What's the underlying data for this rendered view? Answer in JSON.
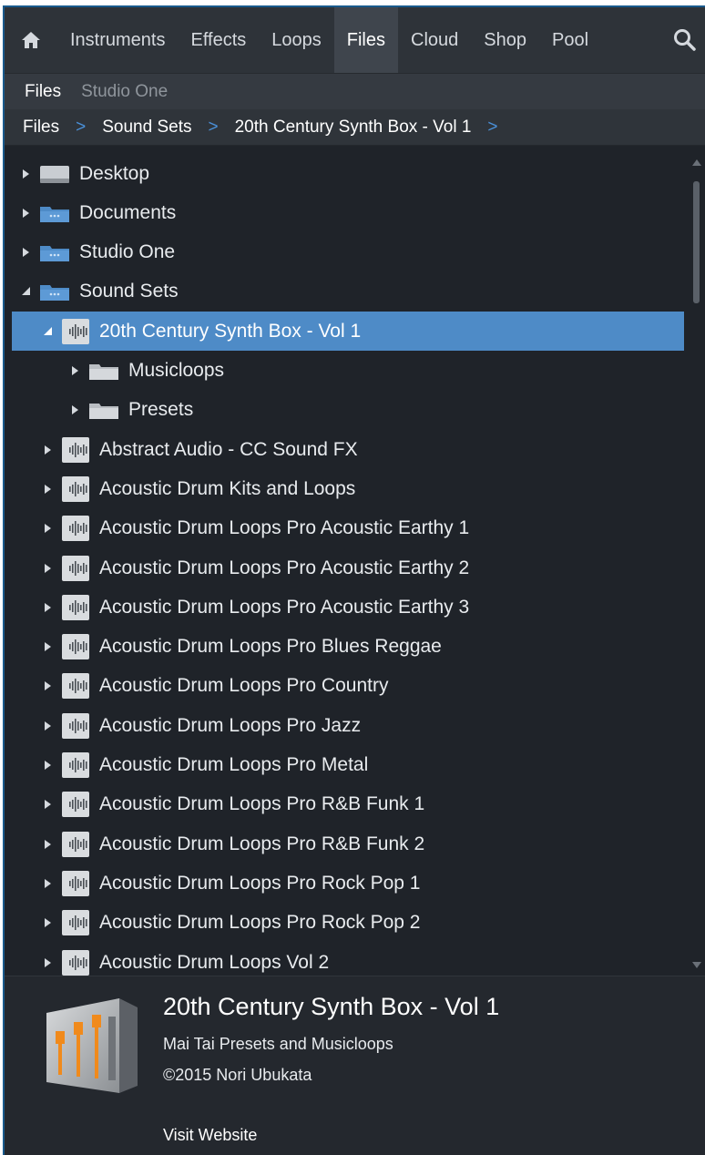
{
  "topbar": {
    "tabs": [
      "Instruments",
      "Effects",
      "Loops",
      "Files",
      "Cloud",
      "Shop",
      "Pool"
    ],
    "active_tab": "Files",
    "home_icon": "home-icon",
    "search_icon": "search-icon"
  },
  "subbar": {
    "tabs": [
      "Files",
      "Studio One"
    ],
    "active": "Files"
  },
  "breadcrumb": [
    "Files",
    "Sound Sets",
    "20th Century Synth Box - Vol 1"
  ],
  "breadcrumb_sep": ">",
  "tree": {
    "rows": [
      {
        "label": "Desktop",
        "icon": "drive-icon",
        "level": 0,
        "expanded": false
      },
      {
        "label": "Documents",
        "icon": "folder-icon",
        "level": 0,
        "expanded": false
      },
      {
        "label": "Studio One",
        "icon": "folder-icon",
        "level": 0,
        "expanded": false
      },
      {
        "label": "Sound Sets",
        "icon": "folder-icon",
        "level": 0,
        "expanded": true
      },
      {
        "label": "20th Century Synth Box - Vol 1",
        "icon": "soundset-icon",
        "level": 1,
        "expanded": true,
        "selected": true
      },
      {
        "label": "Musicloops",
        "icon": "folder-icon",
        "level": 2,
        "expanded": false
      },
      {
        "label": "Presets",
        "icon": "folder-icon",
        "level": 2,
        "expanded": false
      },
      {
        "label": "Abstract Audio -  CC Sound FX",
        "icon": "soundset-icon",
        "level": 1,
        "expanded": false
      },
      {
        "label": "Acoustic Drum Kits and Loops",
        "icon": "soundset-icon",
        "level": 1,
        "expanded": false
      },
      {
        "label": "Acoustic Drum Loops Pro Acoustic Earthy 1",
        "icon": "soundset-icon",
        "level": 1,
        "expanded": false
      },
      {
        "label": "Acoustic Drum Loops Pro Acoustic Earthy 2",
        "icon": "soundset-icon",
        "level": 1,
        "expanded": false
      },
      {
        "label": "Acoustic Drum Loops Pro Acoustic Earthy 3",
        "icon": "soundset-icon",
        "level": 1,
        "expanded": false
      },
      {
        "label": "Acoustic Drum Loops Pro Blues Reggae",
        "icon": "soundset-icon",
        "level": 1,
        "expanded": false
      },
      {
        "label": "Acoustic Drum Loops Pro Country",
        "icon": "soundset-icon",
        "level": 1,
        "expanded": false
      },
      {
        "label": "Acoustic Drum Loops Pro Jazz",
        "icon": "soundset-icon",
        "level": 1,
        "expanded": false
      },
      {
        "label": "Acoustic Drum Loops Pro Metal",
        "icon": "soundset-icon",
        "level": 1,
        "expanded": false
      },
      {
        "label": "Acoustic Drum Loops Pro R&B Funk 1",
        "icon": "soundset-icon",
        "level": 1,
        "expanded": false
      },
      {
        "label": "Acoustic Drum Loops Pro R&B Funk 2",
        "icon": "soundset-icon",
        "level": 1,
        "expanded": false
      },
      {
        "label": "Acoustic Drum Loops Pro Rock Pop 1",
        "icon": "soundset-icon",
        "level": 1,
        "expanded": false
      },
      {
        "label": "Acoustic Drum Loops Pro Rock Pop 2",
        "icon": "soundset-icon",
        "level": 1,
        "expanded": false
      },
      {
        "label": "Acoustic Drum Loops Vol 2",
        "icon": "soundset-icon",
        "level": 1,
        "expanded": false
      }
    ]
  },
  "info": {
    "title": "20th Century Synth Box - Vol 1",
    "subtitle": "Mai Tai Presets and Musicloops",
    "copyright": "©2015 Nori Ubukata",
    "link": "Visit Website"
  },
  "colors": {
    "background": "#1f2329",
    "selected": "#4e8bc7",
    "accent": "#4a90d9"
  }
}
